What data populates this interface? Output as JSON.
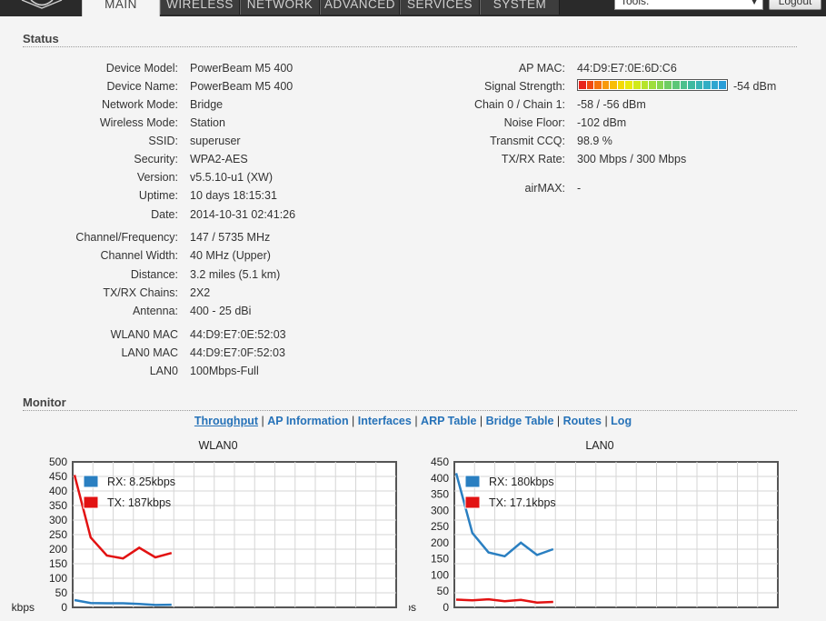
{
  "tabs": [
    {
      "label": "MAIN",
      "active": true
    },
    {
      "label": "WIRELESS",
      "active": false
    },
    {
      "label": "NETWORK",
      "active": false
    },
    {
      "label": "ADVANCED",
      "active": false
    },
    {
      "label": "SERVICES",
      "active": false
    },
    {
      "label": "SYSTEM",
      "active": false
    }
  ],
  "header": {
    "tools_value": "Tools:",
    "logout_label": "Logout"
  },
  "status": {
    "title": "Status",
    "left": [
      {
        "label": "Device Model:",
        "value": "PowerBeam M5 400"
      },
      {
        "label": "Device Name:",
        "value": "PowerBeam M5 400"
      },
      {
        "label": "Network Mode:",
        "value": "Bridge"
      },
      {
        "label": "Wireless Mode:",
        "value": "Station"
      },
      {
        "label": "SSID:",
        "value": "superuser"
      },
      {
        "label": "Security:",
        "value": "WPA2-AES"
      },
      {
        "label": "Version:",
        "value": "v5.5.10-u1 (XW)"
      },
      {
        "label": "Uptime:",
        "value": "10 days 18:15:31"
      },
      {
        "label": "Date:",
        "value": "2014-10-31 02:41:26"
      },
      {
        "label": "Channel/Frequency:",
        "value": "147 / 5735 MHz"
      },
      {
        "label": "Channel Width:",
        "value": "40 MHz (Upper)"
      },
      {
        "label": "Distance:",
        "value": "3.2 miles (5.1 km)"
      },
      {
        "label": "TX/RX Chains:",
        "value": "2X2"
      },
      {
        "label": "Antenna:",
        "value": "400 - 25 dBi"
      },
      {
        "label": "WLAN0 MAC",
        "value": "44:D9:E7:0E:52:03"
      },
      {
        "label": "LAN0 MAC",
        "value": "44:D9:E7:0F:52:03"
      },
      {
        "label": "LAN0",
        "value": "100Mbps-Full"
      }
    ],
    "right": [
      {
        "label": "AP MAC:",
        "value": "44:D9:E7:0E:6D:C6"
      },
      {
        "label": "Signal Strength:",
        "value": "-54 dBm"
      },
      {
        "label": "Chain 0 / Chain 1:",
        "value": "-58 / -56 dBm"
      },
      {
        "label": "Noise Floor:",
        "value": "-102 dBm"
      },
      {
        "label": "Transmit CCQ:",
        "value": "98.9 %"
      },
      {
        "label": "TX/RX Rate:",
        "value": "300 Mbps / 300 Mbps"
      },
      {
        "label": "airMAX:",
        "value": "-"
      }
    ],
    "signal_colors": [
      "#e8241c",
      "#f04a12",
      "#f5720e",
      "#f89a0a",
      "#f8bd06",
      "#f4da06",
      "#e9e90c",
      "#d2ea18",
      "#b6e42a",
      "#9ede3c",
      "#86d64e",
      "#6ecd62",
      "#5cc676",
      "#4cc08c",
      "#3fbaa0",
      "#38b4b4",
      "#33aec4",
      "#2fa6d0",
      "#2b9ed8"
    ]
  },
  "monitor": {
    "title": "Monitor",
    "links": [
      "Throughput",
      "AP Information",
      "Interfaces",
      "ARP Table",
      "Bridge Table",
      "Routes",
      "Log"
    ]
  },
  "chart_data": [
    {
      "type": "line",
      "title": "WLAN0",
      "ylabel": "kbps",
      "ylim": [
        0,
        500
      ],
      "yticks": [
        0,
        50,
        100,
        150,
        200,
        250,
        300,
        350,
        400,
        450,
        500
      ],
      "colors": {
        "rx": "#2a7fc1",
        "tx": "#e21212"
      },
      "series": [
        {
          "name": "RX: 8.25kbps",
          "key": "rx",
          "values": [
            25,
            15,
            14,
            14,
            12,
            8,
            9
          ]
        },
        {
          "name": "TX: 187kbps",
          "key": "tx",
          "values": [
            455,
            240,
            178,
            168,
            205,
            172,
            187
          ]
        }
      ]
    },
    {
      "type": "line",
      "title": "LAN0",
      "ylabel": "kbps",
      "ylim": [
        0,
        450
      ],
      "yticks": [
        0,
        50,
        100,
        150,
        200,
        250,
        300,
        350,
        400,
        450
      ],
      "colors": {
        "rx": "#2a7fc1",
        "tx": "#e21212"
      },
      "series": [
        {
          "name": "RX: 180kbps",
          "key": "rx",
          "values": [
            415,
            230,
            170,
            158,
            200,
            162,
            180
          ]
        },
        {
          "name": "TX: 17.1kbps",
          "key": "tx",
          "values": [
            24,
            22,
            25,
            19,
            23,
            15,
            17
          ]
        }
      ]
    }
  ]
}
